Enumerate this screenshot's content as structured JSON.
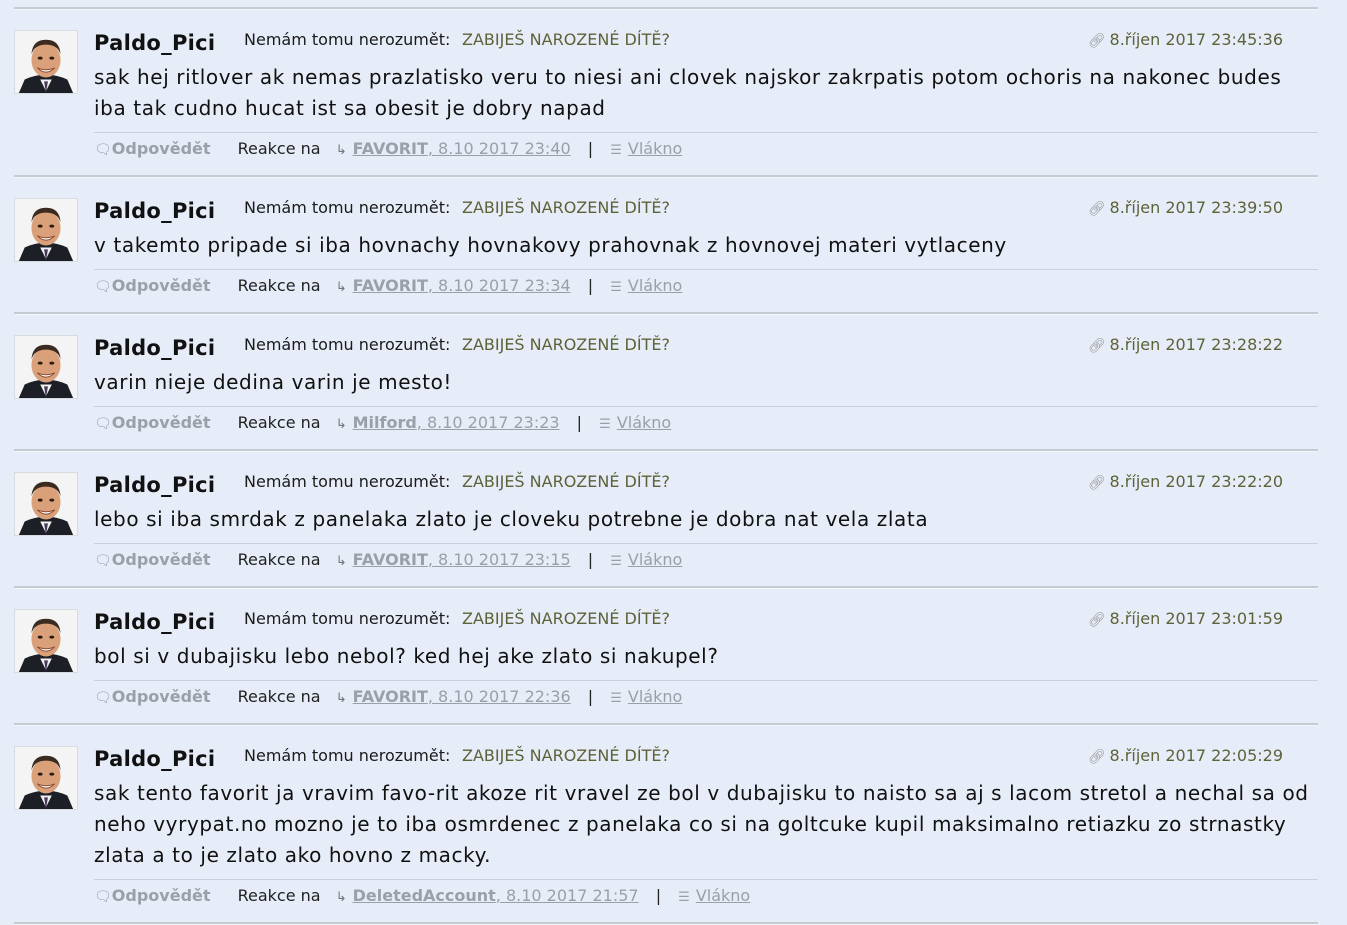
{
  "labels": {
    "reply": "Odpovědět",
    "reakce": "Reakce na",
    "thread": "Vlákno",
    "topic_label": "Nemám tomu nerozumět:"
  },
  "icons": {
    "reply": "speech-bubble-icon",
    "date": "link-icon",
    "reaction": "reply-arrow-icon",
    "thread": "thread-icon"
  },
  "posts": [
    {
      "author": "Paldo_Pici",
      "topic": "ZABIJEŠ NAROZENÉ DÍTĚ?",
      "date": "8.říjen 2017 23:45:36",
      "text": "sak hej ritlover ak nemas prazlatisko veru to niesi ani clovek najskor zakrpatis potom ochoris na nakonec budes iba tak cudno hucat ist sa obesit je dobry napad",
      "ref_user": "FAVORIT",
      "ref_date": ", 8.10 2017 23:40"
    },
    {
      "author": "Paldo_Pici",
      "topic": "ZABIJEŠ NAROZENÉ DÍTĚ?",
      "date": "8.říjen 2017 23:39:50",
      "text": "v takemto pripade si iba hovnachy hovnakovy prahovnak z hovnovej materi vytlaceny",
      "ref_user": "FAVORIT",
      "ref_date": ", 8.10 2017 23:34"
    },
    {
      "author": "Paldo_Pici",
      "topic": "ZABIJEŠ NAROZENÉ DÍTĚ?",
      "date": "8.říjen 2017 23:28:22",
      "text": "varin nieje dedina varin je mesto!",
      "ref_user": "Milford",
      "ref_date": ", 8.10 2017 23:23"
    },
    {
      "author": "Paldo_Pici",
      "topic": "ZABIJEŠ NAROZENÉ DÍTĚ?",
      "date": "8.říjen 2017 23:22:20",
      "text": "lebo si iba smrdak z panelaka zlato je cloveku potrebne je dobra nat vela zlata",
      "ref_user": "FAVORIT",
      "ref_date": ", 8.10 2017 23:15"
    },
    {
      "author": "Paldo_Pici",
      "topic": "ZABIJEŠ NAROZENÉ DÍTĚ?",
      "date": "8.říjen 2017 23:01:59",
      "text": "bol si v dubajisku lebo nebol? ked hej ake zlato si nakupel?",
      "ref_user": "FAVORIT",
      "ref_date": ", 8.10 2017 22:36"
    },
    {
      "author": "Paldo_Pici",
      "topic": "ZABIJEŠ NAROZENÉ DÍTĚ?",
      "date": "8.říjen 2017 22:05:29",
      "text": "sak tento favorit ja vravim favo-rit akoze rit vravel ze bol v dubajisku to naisto sa aj s lacom stretol a nechal sa od neho vyrypat.no mozno je to iba osmrdenec z panelaka co si na goltcuke kupil maksimalno retiazku zo strnastky zlata a to je zlato ako hovno z macky.",
      "ref_user": "DeletedAccount",
      "ref_date": ", 8.10 2017 21:57"
    }
  ]
}
